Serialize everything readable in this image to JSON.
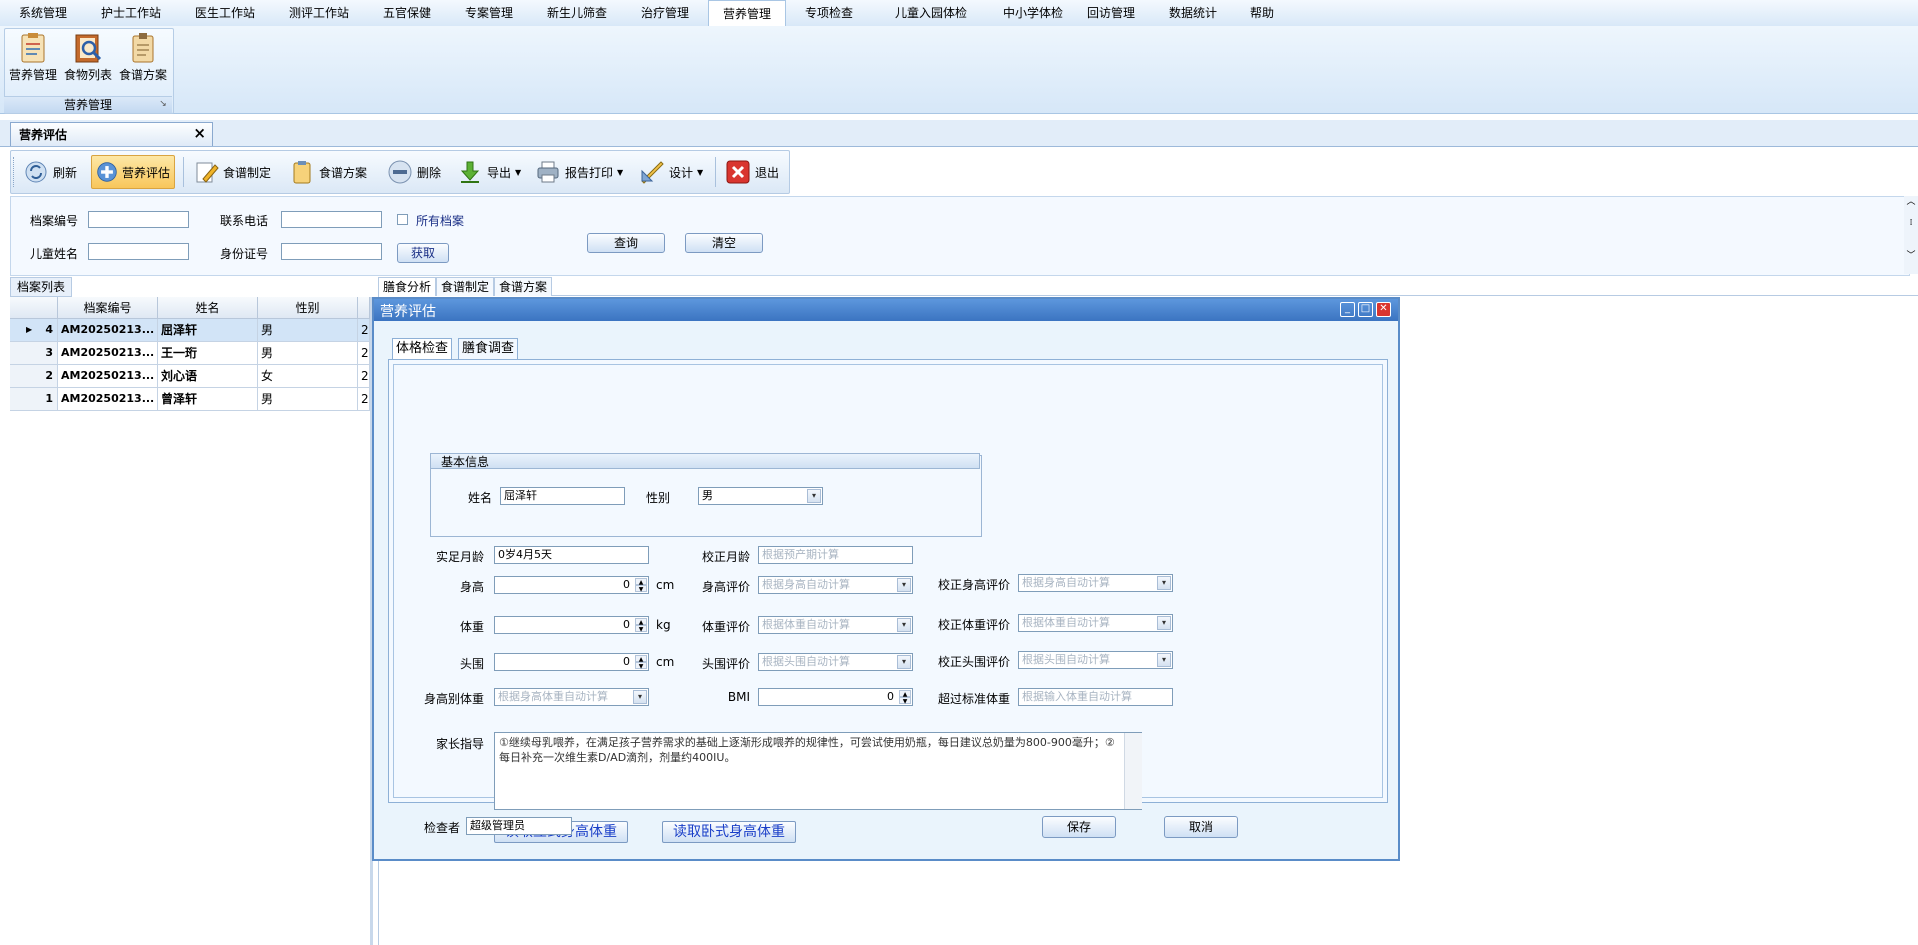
{
  "menu": {
    "items": [
      "系统管理",
      "护士工作站",
      "医生工作站",
      "测评工作站",
      "五官保健",
      "专案管理",
      "新生儿筛查",
      "治疗管理",
      "营养管理",
      "专项检查",
      "儿童入园体检",
      "中小学体检",
      "回访管理",
      "数据统计",
      "帮助"
    ],
    "active_index": 8
  },
  "ribbon": {
    "buttons": [
      {
        "label": "营养管理",
        "icon": "nutrition-management-icon"
      },
      {
        "label": "食物列表",
        "icon": "food-list-icon"
      },
      {
        "label": "食谱方案",
        "icon": "recipe-plan-icon"
      }
    ],
    "group_label": "营养管理"
  },
  "doc_tab": {
    "label": "营养评估"
  },
  "toolbar": {
    "refresh": "刷新",
    "assess": "营养评估",
    "recipe_make": "食谱制定",
    "recipe_plan": "食谱方案",
    "delete": "删除",
    "export": "导出",
    "report_print": "报告打印",
    "design": "设计",
    "exit": "退出"
  },
  "search": {
    "file_no_label": "档案编号",
    "phone_label": "联系电话",
    "all_files_label": "所有档案",
    "child_name_label": "儿童姓名",
    "id_card_label": "身份证号",
    "fetch_button": "获取",
    "query_button": "查询",
    "clear_button": "清空"
  },
  "file_list": {
    "tab_label": "档案列表",
    "columns": [
      "档案编号",
      "姓名",
      "性别"
    ],
    "rows": [
      {
        "num": "4",
        "code": "AM20250213...",
        "name": "屈泽轩",
        "gender": "男",
        "extra": "2",
        "selected": true
      },
      {
        "num": "3",
        "code": "AM20250213...",
        "name": "王一珩",
        "gender": "男",
        "extra": "2",
        "selected": false
      },
      {
        "num": "2",
        "code": "AM20250213...",
        "name": "刘心语",
        "gender": "女",
        "extra": "2",
        "selected": false
      },
      {
        "num": "1",
        "code": "AM20250213...",
        "name": "曾泽轩",
        "gender": "男",
        "extra": "2",
        "selected": false
      }
    ]
  },
  "right_tabs": [
    "膳食分析",
    "食谱制定",
    "食谱方案"
  ],
  "dialog": {
    "title": "营养评估",
    "tabs": [
      "体格检查",
      "膳食调查"
    ],
    "basic_info_title": "基本信息",
    "name_label": "姓名",
    "name_value": "屈泽轩",
    "gender_label": "性别",
    "gender_value": "男",
    "actual_age_label": "实足月龄",
    "actual_age_value": "0岁4月5天",
    "corrected_age_label": "校正月龄",
    "corrected_age_placeholder": "根据预产期计算",
    "height_label": "身高",
    "height_value": "0",
    "height_unit": "cm",
    "height_eval_label": "身高评价",
    "height_eval_placeholder": "根据身高自动计算",
    "corr_height_eval_label": "校正身高评价",
    "corr_height_eval_placeholder": "根据身高自动计算",
    "weight_label": "体重",
    "weight_value": "0",
    "weight_unit": "kg",
    "weight_eval_label": "体重评价",
    "weight_eval_placeholder": "根据体重自动计算",
    "corr_weight_eval_label": "校正体重评价",
    "corr_weight_eval_placeholder": "根据体重自动计算",
    "head_label": "头围",
    "head_value": "0",
    "head_unit": "cm",
    "head_eval_label": "头围评价",
    "head_eval_placeholder": "根据头围自动计算",
    "corr_head_eval_label": "校正头围评价",
    "corr_head_eval_placeholder": "根据头围自动计算",
    "wfh_label": "身高别体重",
    "wfh_placeholder": "根据身高体重自动计算",
    "bmi_label": "BMI",
    "bmi_value": "0",
    "over_std_label": "超过标准体重",
    "over_std_placeholder": "根据输入体重自动计算",
    "guidance_label": "家长指导",
    "guidance_text": "①继续母乳喂养，在满足孩子营养需求的基础上逐渐形成喂养的规律性，可尝试使用奶瓶，每日建议总奶量为800-900毫升；②每日补充一次维生素D/AD滴剂，剂量约400IU。",
    "read_standing_button": "读取立式身高体重",
    "read_lying_button": "读取卧式身高体重",
    "examiner_label": "检查者",
    "examiner_value": "超级管理员",
    "save_button": "保存",
    "cancel_button": "取消"
  }
}
